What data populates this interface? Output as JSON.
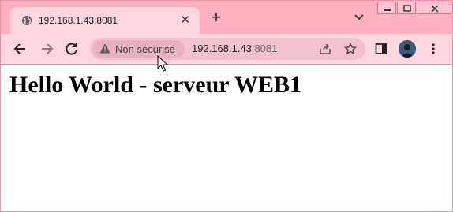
{
  "tab": {
    "title": "192.168.1.43:8081"
  },
  "address_bar": {
    "security_label": "Non sécurisé",
    "host": "192.168.1.43",
    "port": ":8081"
  },
  "page": {
    "heading": "Hello World - serveur WEB1"
  },
  "colors": {
    "frame": "#ffb0bf",
    "toolbar": "#ffd6de",
    "omnibox": "#f4c2cc"
  },
  "icons": [
    "globe-icon",
    "tab-close-icon",
    "new-tab-icon",
    "tab-search-icon",
    "minimize-icon",
    "maximize-icon",
    "window-close-icon",
    "back-icon",
    "forward-icon",
    "reload-icon",
    "warning-icon",
    "share-icon",
    "bookmark-star-icon",
    "side-panel-icon",
    "profile-avatar",
    "menu-kebab-icon",
    "mouse-cursor-icon"
  ]
}
